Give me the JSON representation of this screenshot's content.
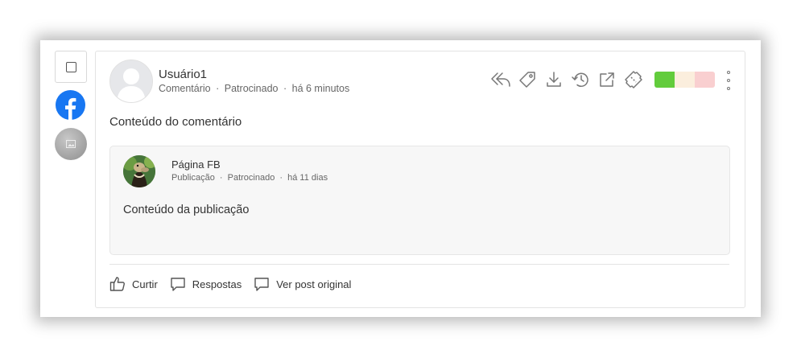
{
  "user": {
    "name": "Usuário1",
    "type": "Comentário",
    "sponsored": "Patrocinado",
    "time": "há 6 minutos"
  },
  "comment": {
    "text": "Conteúdo do comentário"
  },
  "post": {
    "page_name": "Página FB",
    "type": "Publicação",
    "sponsored": "Patrocinado",
    "time": "há 11 dias",
    "text": "Conteúdo da publicação"
  },
  "footer": {
    "like_label": "Curtir",
    "replies_label": "Respostas",
    "original_label": "Ver post original"
  },
  "meta_separator": "·",
  "actions": [
    "reply-icon",
    "tag-icon",
    "download-icon",
    "history-icon",
    "external-link-icon",
    "ticket-icon"
  ],
  "sentiment_colors": {
    "positive": "#62cc3c",
    "neutral": "#fbeedd",
    "negative": "#f9cfd0"
  },
  "colors": {
    "facebook": "#1877f2"
  }
}
